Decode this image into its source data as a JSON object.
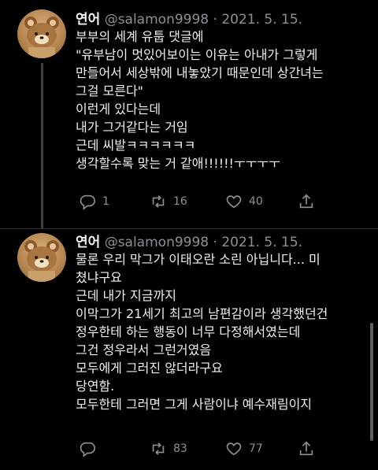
{
  "tweets": [
    {
      "name": "연어",
      "handle": "@salamon9998",
      "separator": "·",
      "date": "2021. 5. 15.",
      "lines": [
        "부부의 세계 유툽 댓글에",
        "\"유부남이 멋있어보이는 이유는 아내가 그렇게",
        "만들어서 세상밖에 내놓았기 때문인데 상간녀는",
        "그걸 모른다\"",
        "이런게 있다는데",
        "내가 그거같다는 거임",
        "근데 씨발ㅋㅋㅋㅋㅋㅋ",
        "생각할수록 맞는 거 같애!!!!!!ㅜㅜㅜㅜ"
      ],
      "replies": "1",
      "retweets": "16",
      "likes": "40"
    },
    {
      "name": "연어",
      "handle": "@salamon9998",
      "separator": "·",
      "date": "2021. 5. 15.",
      "lines": [
        "물론 우리 막그가 이태오란 소린 아닙니다... 미",
        "쳤냐구요",
        "근데 내가 지금까지",
        "이막그가 21세기 최고의 남편감이라 생각했던건",
        "정우한테 하는 행동이 너무 다정해서였는데",
        "그건 정우라서 그런거였음",
        "모두에게 그러진 않더라구요",
        "당연함.",
        "모두한테 그러면 그게 사람이냐 예수재림이지"
      ],
      "replies": "",
      "retweets": "83",
      "likes": "77"
    }
  ],
  "icons": {
    "reply": "reply-icon",
    "retweet": "retweet-icon",
    "like": "heart-icon",
    "share": "share-icon"
  },
  "colors": {
    "background": "#000000",
    "text": "#e7e9ea",
    "muted": "#8b9197"
  }
}
